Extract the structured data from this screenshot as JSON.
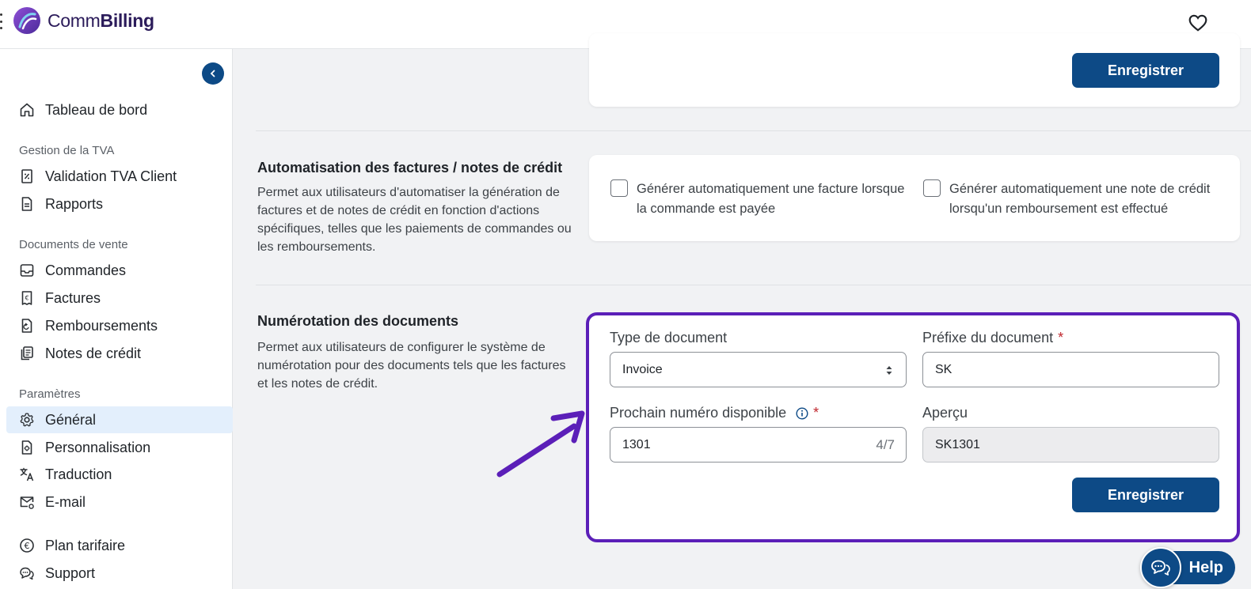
{
  "app": {
    "logo_prefix": "Comm",
    "logo_suffix": "Billing",
    "colors": {
      "primary": "#0d4a86",
      "highlight": "#5b1fb8",
      "active_bg": "#e3effc"
    }
  },
  "sidebar": {
    "items": [
      {
        "label": "Tableau de bord",
        "icon": "home-icon"
      },
      {
        "label": "Validation TVA Client",
        "icon": "receipt-percent-icon"
      },
      {
        "label": "Rapports",
        "icon": "document-icon"
      },
      {
        "label": "Commandes",
        "icon": "inbox-icon"
      },
      {
        "label": "Factures",
        "icon": "euro-document-icon"
      },
      {
        "label": "Remboursements",
        "icon": "refund-document-icon"
      },
      {
        "label": "Notes de crédit",
        "icon": "credit-note-icon"
      },
      {
        "label": "Général",
        "icon": "gear-icon",
        "active": true
      },
      {
        "label": "Personnalisation",
        "icon": "customize-document-icon"
      },
      {
        "label": "Traduction",
        "icon": "translate-icon"
      },
      {
        "label": "E-mail",
        "icon": "email-gear-icon"
      },
      {
        "label": "Plan tarifaire",
        "icon": "euro-circle-icon"
      },
      {
        "label": "Support",
        "icon": "chat-bubbles-icon"
      }
    ],
    "sections": {
      "tva": "Gestion de la TVA",
      "sales": "Documents de vente",
      "settings": "Paramètres"
    }
  },
  "main": {
    "top_card": {
      "save_label": "Enregistrer"
    },
    "automation": {
      "title": "Automatisation des factures / notes de crédit",
      "description": "Permet aux utilisateurs d'automatiser la génération de factures et de notes de crédit en fonction d'actions spécifiques, telles que les paiements de commandes ou les remboursements.",
      "options": [
        {
          "label": "Générer automatiquement une facture lorsque la commande est payée",
          "checked": false
        },
        {
          "label": "Générer automatiquement une note de crédit lorsqu'un remboursement est effectué",
          "checked": false
        }
      ]
    },
    "numbering": {
      "title": "Numérotation des documents",
      "description": "Permet aux utilisateurs de configurer le système de numérotation pour des documents tels que les factures et les notes de crédit.",
      "type_label": "Type de document",
      "type_value": "Invoice",
      "prefix_label": "Préfixe du document",
      "prefix_value": "SK",
      "next_label": "Prochain numéro disponible",
      "next_value": "1301",
      "next_counter": "4/7",
      "preview_label": "Aperçu",
      "preview_value": "SK1301",
      "required_mark": "*",
      "save_label": "Enregistrer"
    }
  },
  "help": {
    "label": "Help"
  }
}
